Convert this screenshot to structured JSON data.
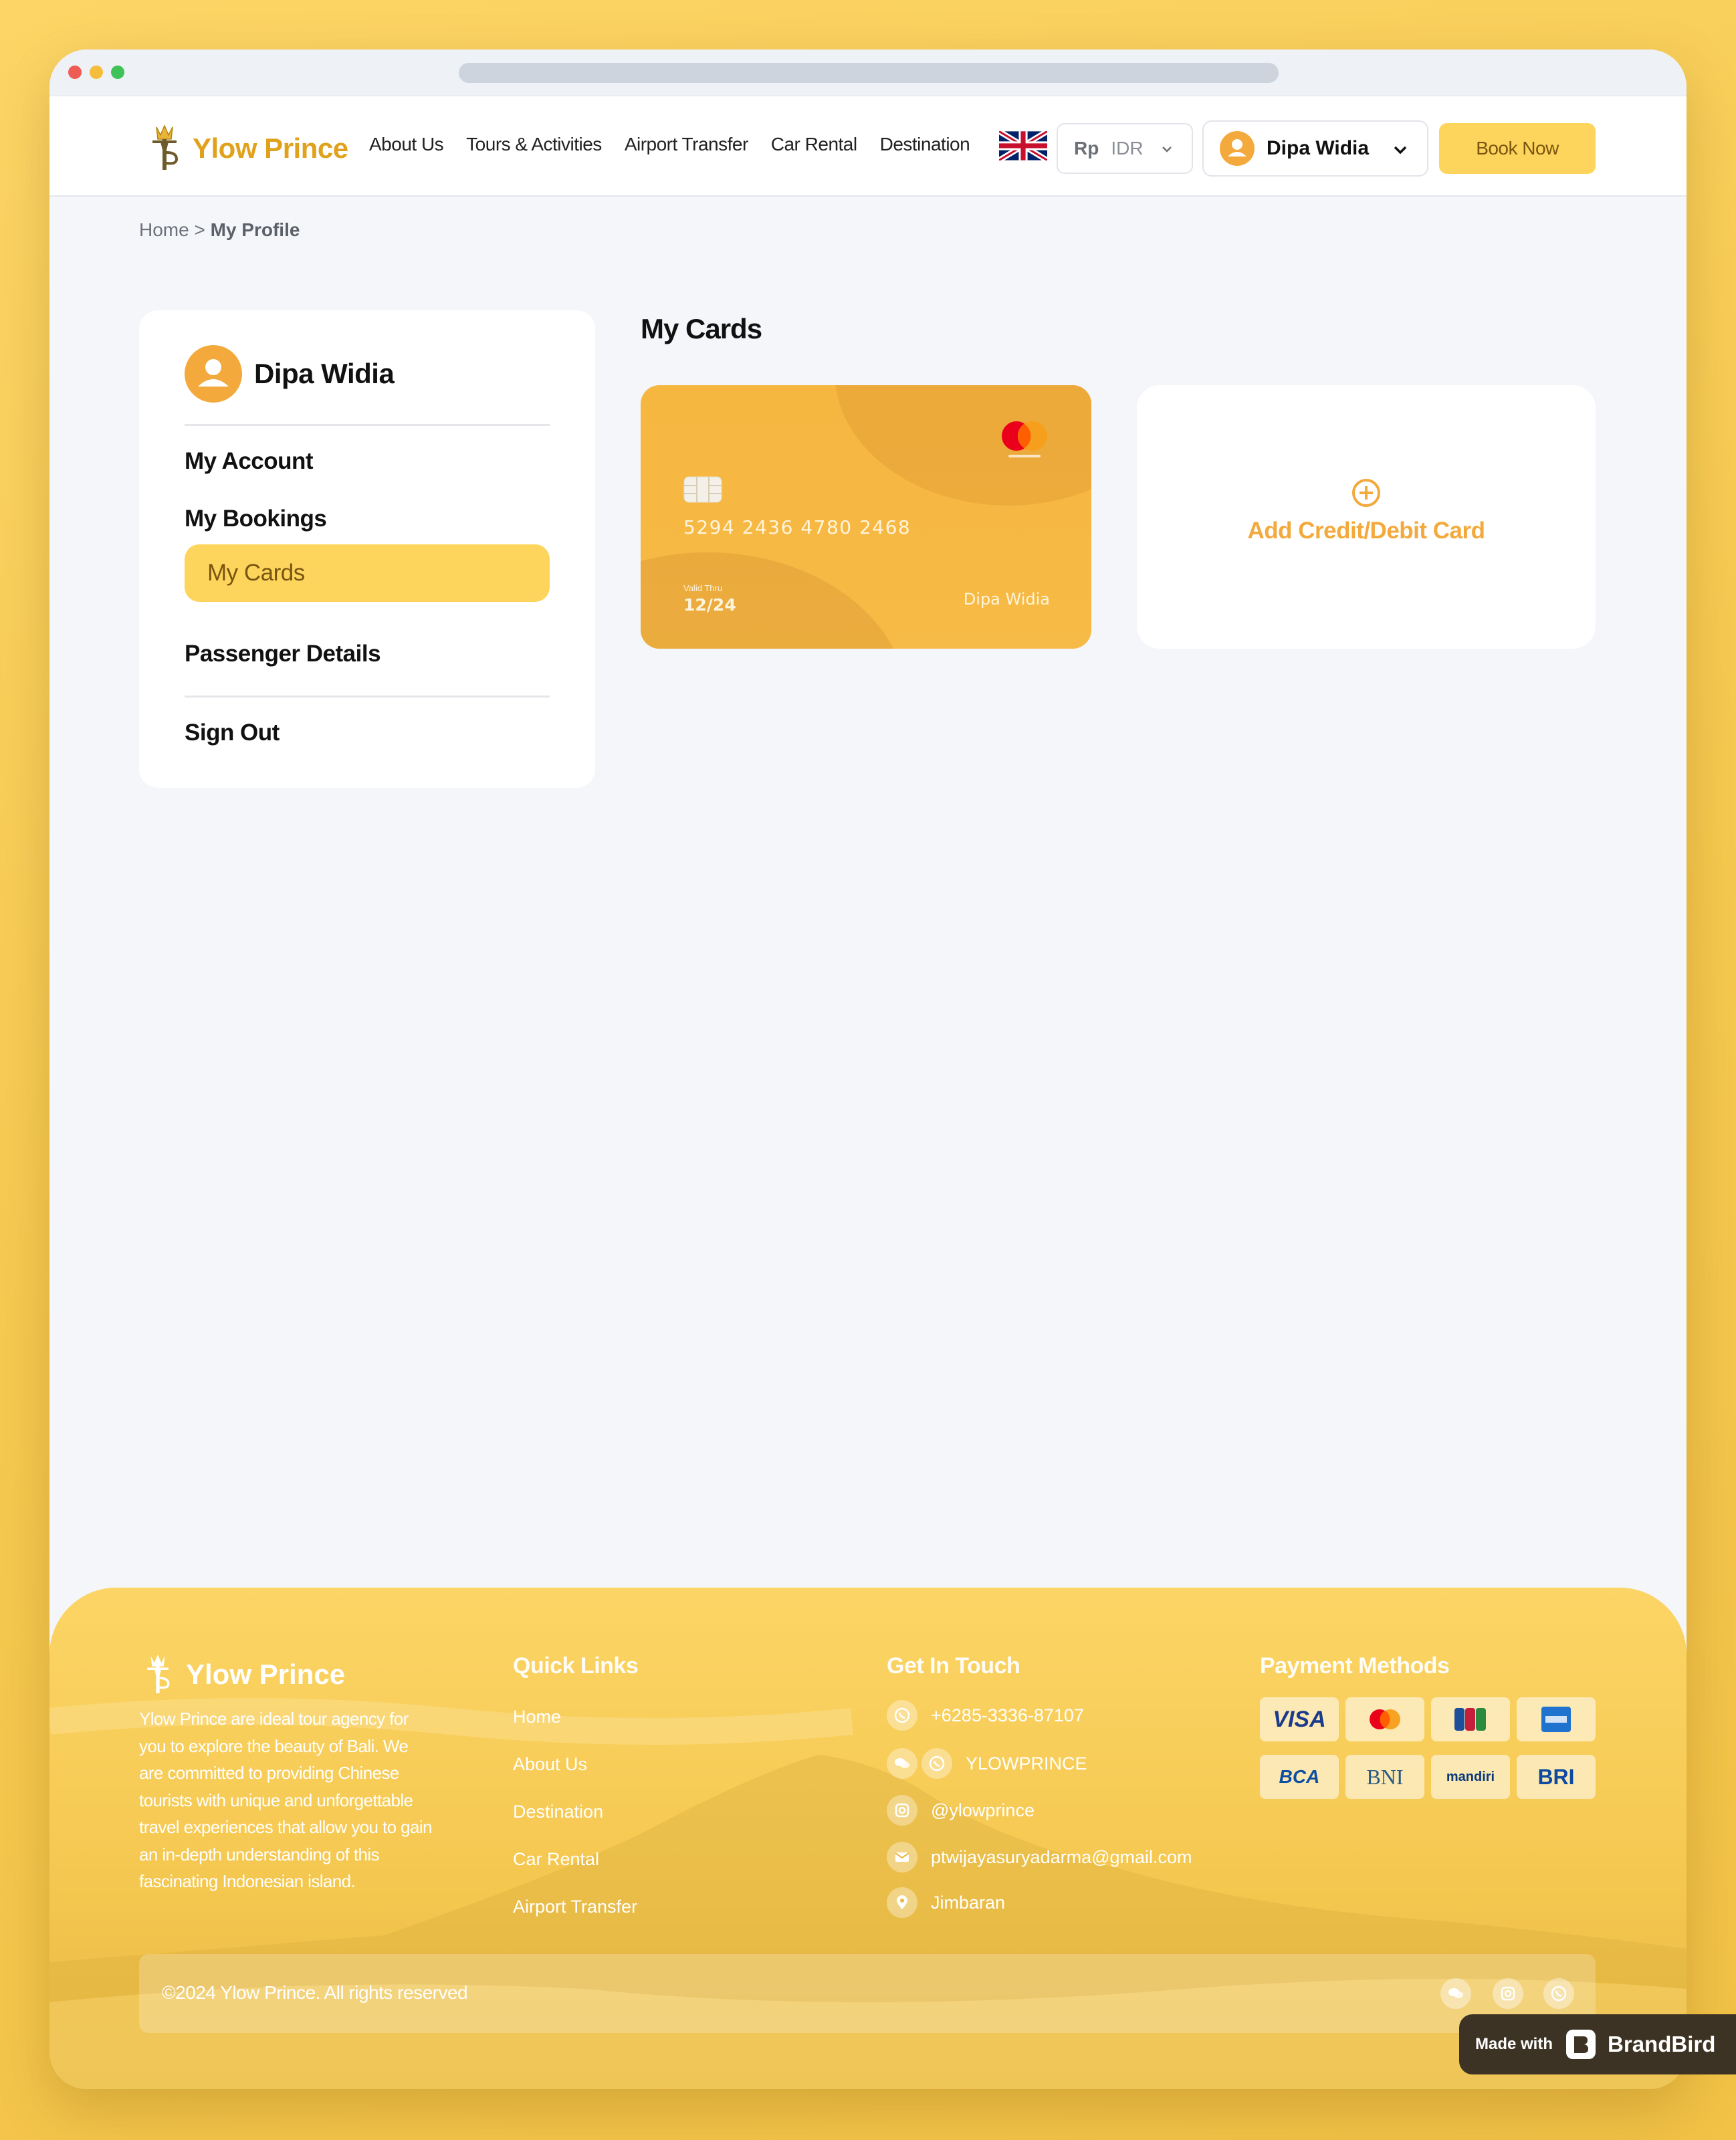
{
  "brand": {
    "name": "Ylow Prince"
  },
  "nav": {
    "links": [
      "About Us",
      "Tours & Activities",
      "Airport Transfer",
      "Car Rental",
      "Destination"
    ],
    "currency_symbol": "Rp",
    "currency_code": "IDR",
    "user_name": "Dipa Widia",
    "book_now": "Book Now"
  },
  "breadcrumb": {
    "home": "Home",
    "separator": ">",
    "current": "My Profile"
  },
  "sidebar": {
    "user_name": "Dipa Widia",
    "items": [
      "My Account",
      "My Bookings",
      "My Cards",
      "Passenger Details"
    ],
    "active_item": "My Cards",
    "sign_out": "Sign Out"
  },
  "cards_section": {
    "title": "My Cards",
    "card": {
      "brand": "mastercard",
      "number": "5294 2436 4780 2468",
      "valid_label": "Valid Thru",
      "valid_thru": "12/24",
      "holder": "Dipa Widia"
    },
    "add_card_label": "Add Credit/Debit Card"
  },
  "footer": {
    "brand": "Ylow Prince",
    "description": "Ylow Prince are ideal tour agency for you to explore the beauty of Bali. We are committed to providing Chinese tourists with unique and unforgettable travel experiences that allow you to gain an in-depth understanding of this fascinating Indonesian island.",
    "quick_links_title": "Quick Links",
    "quick_links": [
      "Home",
      "About Us",
      "Destination",
      "Car Rental",
      "Airport Transfer"
    ],
    "contact_title": "Get In Touch",
    "contacts": {
      "phone": "+6285-3336-87107",
      "wechat": "YLOWPRINCE",
      "instagram": "@ylowprince",
      "email": "ptwijayasuryadarma@gmail.com",
      "location": "Jimbaran"
    },
    "payment_title": "Payment Methods",
    "payment_methods": {
      "visa": "VISA",
      "bca": "BCA",
      "bni": "BNI",
      "mandiri": "mandiri",
      "bri": "BRI"
    },
    "copyright": "©2024 Ylow Prince. All rights reserved"
  },
  "badge": {
    "made_with": "Made with",
    "brand": "BrandBird"
  },
  "colors": {
    "accent": "#fdd55d",
    "brand_orange": "#f3a93b",
    "brand_text": "#e0a21c",
    "background": "#f4f6fa"
  }
}
